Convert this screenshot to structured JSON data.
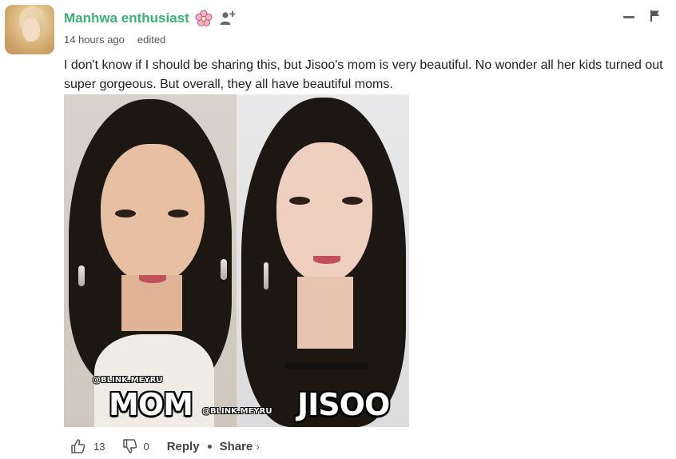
{
  "comment": {
    "username": "Manhwa enthusiast",
    "time": "14 hours ago",
    "edited_label": "edited",
    "text": "I don't know if I should be sharing this, but Jisoo's mom is very beautiful. No wonder all her kids turned out super gorgeous. But overall, they all have beautiful moms.",
    "badge_icon": "flower-badge-icon",
    "follow_icon": "add-follow-icon",
    "accent_color": "#3ab07c"
  },
  "image": {
    "left_caption": "MOM",
    "right_caption": "JISOO",
    "watermark_left": "@BLINK.MEYRU",
    "watermark_center": "@BLINK.MEYRU"
  },
  "actions": {
    "like_count": "13",
    "dislike_count": "0",
    "reply_label": "Reply",
    "share_label": "Share",
    "share_chevron": "›"
  }
}
